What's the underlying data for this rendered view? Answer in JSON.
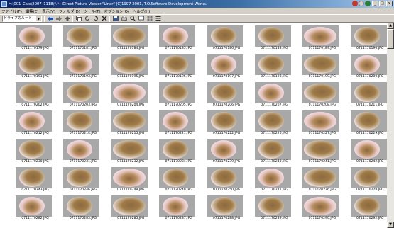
{
  "window": {
    "title": "H:\\001_Cats\\2007_1118\\*.* - Direct Picture Viewer \"Linar\" (C)1997-2001, T.O.Software Development Works.",
    "buttons": [
      "_",
      "□",
      "×"
    ]
  },
  "menu": [
    "ファイル(F)",
    "編集(E)",
    "表示(V)",
    "フォルダ(D)",
    "ツール(T)",
    "オプション(O)",
    "ヘルプ(H)"
  ],
  "toolbar": {
    "combo_value": "ドライブのルート",
    "combo_arrow": "▼"
  },
  "thumbnails": [
    {
      "caption": "0711170179.JPG"
    },
    {
      "caption": "0711170181.JPG"
    },
    {
      "caption": "0711170184.JPG"
    },
    {
      "caption": "0711170185.JPG"
    },
    {
      "caption": "0711170186.JPG"
    },
    {
      "caption": "0711170188.JPG"
    },
    {
      "caption": "0711170189.JPG"
    },
    {
      "caption": "0711170190.JPG"
    },
    {
      "caption": "0711170191.JPG"
    },
    {
      "caption": "0711170193.JPG"
    },
    {
      "caption": "0711170195.JPG"
    },
    {
      "caption": "0711170196.JPG"
    },
    {
      "caption": "0711170197.JPG"
    },
    {
      "caption": "0711170198.JPG"
    },
    {
      "caption": "0711170199.JPG"
    },
    {
      "caption": "0711170200.JPG"
    },
    {
      "caption": "0711170202.JPG"
    },
    {
      "caption": "0711170203.JPG"
    },
    {
      "caption": "0711170204.JPG"
    },
    {
      "caption": "0711170205.JPG"
    },
    {
      "caption": "0711170206.JPG"
    },
    {
      "caption": "0711170207.JPG"
    },
    {
      "caption": "0711170208.JPG"
    },
    {
      "caption": "0711170211.JPG"
    },
    {
      "caption": "0711170212.JPG"
    },
    {
      "caption": "0711170214.JPG"
    },
    {
      "caption": "0711170215.JPG"
    },
    {
      "caption": "0711170221.JPG"
    },
    {
      "caption": "0711170222.JPG"
    },
    {
      "caption": "0711170226.JPG"
    },
    {
      "caption": "0711170227.JPG"
    },
    {
      "caption": "0711170229.JPG"
    },
    {
      "caption": "0711170230.JPG"
    },
    {
      "caption": "0711170231.JPG"
    },
    {
      "caption": "0711170232.JPG"
    },
    {
      "caption": "0711170234.JPG"
    },
    {
      "caption": "0711170239.JPG"
    },
    {
      "caption": "0711170240.JPG"
    },
    {
      "caption": "0711170241.JPG"
    },
    {
      "caption": "0711170242.JPG"
    },
    {
      "caption": "0711170243.JPG"
    },
    {
      "caption": "0711170246.JPG"
    },
    {
      "caption": "0711170248.JPG"
    },
    {
      "caption": "0711170249.JPG"
    },
    {
      "caption": "0711170250.JPG"
    },
    {
      "caption": "0711170271.JPG"
    },
    {
      "caption": "0711170276.JPG"
    },
    {
      "caption": "0711170278.JPG"
    },
    {
      "caption": "0711170282.JPG"
    },
    {
      "caption": "0711170283.JPG"
    },
    {
      "caption": "0711170285.JPG"
    },
    {
      "caption": "0711170287.JPG"
    },
    {
      "caption": "0711170288.JPG"
    },
    {
      "caption": "0711170289.JPG"
    },
    {
      "caption": "0711170290.JPG"
    },
    {
      "caption": "0711170292.JPG"
    }
  ],
  "scrollbar": {
    "up": "▲",
    "down": "▼"
  }
}
